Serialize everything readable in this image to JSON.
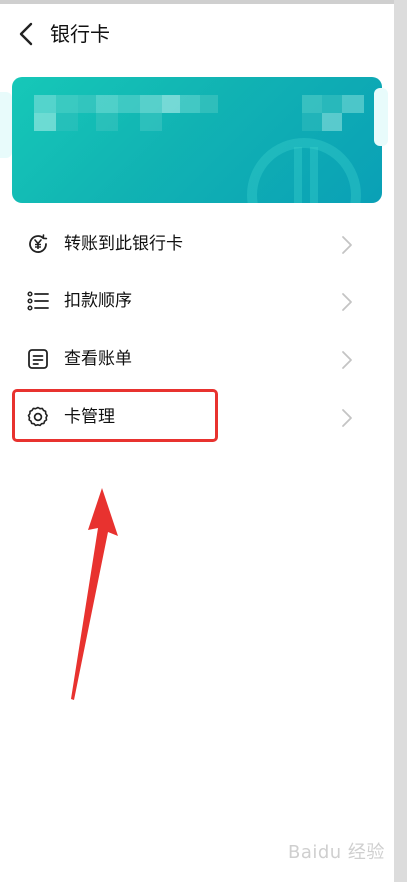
{
  "header": {
    "title": "银行卡"
  },
  "icons": {
    "back": "chevron-left-icon"
  },
  "menu": {
    "items": [
      {
        "label": "转账到此银行卡",
        "icon": "yuan-transfer-icon"
      },
      {
        "label": "扣款顺序",
        "icon": "list-icon"
      },
      {
        "label": "查看账单",
        "icon": "bill-icon"
      },
      {
        "label": "卡管理",
        "icon": "gear-icon"
      }
    ]
  },
  "colors": {
    "card_gradient_start": "#16c8b8",
    "card_gradient_end": "#0aa0b6",
    "annotation_red": "#e8322f"
  },
  "watermark": "Baidu 经验"
}
